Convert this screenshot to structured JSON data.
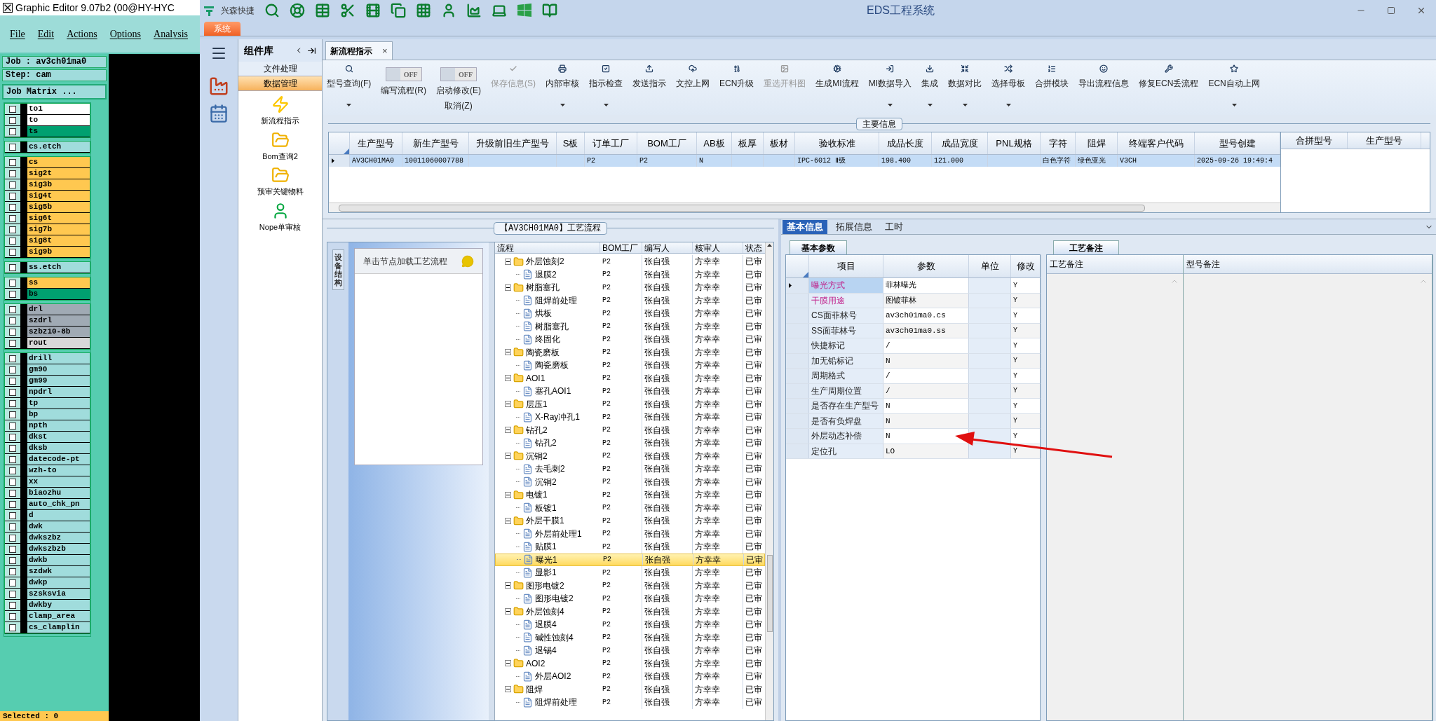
{
  "editor": {
    "title": "Graphic Editor 9.07b2 (00@HY-HYC",
    "menu": [
      "File",
      "Edit",
      "Actions",
      "Options",
      "Analysis"
    ],
    "job": "Job : av3ch01ma0",
    "step": "Step: cam",
    "matrix_button": "Job Matrix ...",
    "layer_groups": [
      [
        {
          "name": "to1",
          "color": "#ffffff",
          "checked": false
        },
        {
          "name": "to",
          "color": "#ffffff",
          "checked": false
        },
        {
          "name": "ts",
          "color": "#00a070",
          "checked": false
        }
      ],
      [
        {
          "name": "cs.etch",
          "color": "#a0dcdc",
          "checked": false
        }
      ],
      [
        {
          "name": "cs",
          "color": "#ffc850",
          "checked": false
        },
        {
          "name": "sig2t",
          "color": "#ffc850",
          "checked": false
        },
        {
          "name": "sig3b",
          "color": "#ffc850",
          "checked": false
        },
        {
          "name": "sig4t",
          "color": "#ffc850",
          "checked": false
        },
        {
          "name": "sig5b",
          "color": "#ffc850",
          "checked": false
        },
        {
          "name": "sig6t",
          "color": "#ffc850",
          "checked": false
        },
        {
          "name": "sig7b",
          "color": "#ffc850",
          "checked": false
        },
        {
          "name": "sig8t",
          "color": "#ffc850",
          "checked": false
        },
        {
          "name": "sig9b",
          "color": "#ffc850",
          "checked": false
        }
      ],
      [
        {
          "name": "ss.etch",
          "color": "#a0dcdc",
          "checked": false
        }
      ],
      [
        {
          "name": "ss",
          "color": "#ffc850",
          "checked": false
        },
        {
          "name": "bs",
          "color": "#00a070",
          "checked": false
        }
      ],
      [
        {
          "name": "drl",
          "color": "#a0aab4",
          "checked": false
        },
        {
          "name": "szdrl",
          "color": "#a0aab4",
          "checked": false
        },
        {
          "name": "szbz10-8b",
          "color": "#a0aab4",
          "checked": false
        },
        {
          "name": "rout",
          "color": "#d8d8d8",
          "checked": false
        }
      ],
      [
        {
          "name": "drill",
          "color": "#a0dcdc",
          "checked": false
        },
        {
          "name": "gm90",
          "color": "#a0dcdc",
          "checked": false
        },
        {
          "name": "gm99",
          "color": "#a0dcdc",
          "checked": false
        },
        {
          "name": "npdrl",
          "color": "#a0dcdc",
          "checked": false
        },
        {
          "name": "tp",
          "color": "#a0dcdc",
          "checked": false
        },
        {
          "name": "bp",
          "color": "#a0dcdc",
          "checked": false
        },
        {
          "name": "npth",
          "color": "#a0dcdc",
          "checked": false
        },
        {
          "name": "dkst",
          "color": "#a0dcdc",
          "checked": false
        },
        {
          "name": "dksb",
          "color": "#a0dcdc",
          "checked": false
        },
        {
          "name": "datecode-pt",
          "color": "#a0dcdc",
          "checked": false
        },
        {
          "name": "wzh-to",
          "color": "#a0dcdc",
          "checked": false
        },
        {
          "name": "xx",
          "color": "#a0dcdc",
          "checked": false
        },
        {
          "name": "biaozhu",
          "color": "#a0dcdc",
          "checked": false
        },
        {
          "name": "auto_chk_pn",
          "color": "#a0dcdc",
          "checked": false
        },
        {
          "name": "d",
          "color": "#a0dcdc",
          "checked": false
        },
        {
          "name": "dwk",
          "color": "#a0dcdc",
          "checked": false
        },
        {
          "name": "dwkszbz",
          "color": "#a0dcdc",
          "checked": false
        },
        {
          "name": "dwkszbzb",
          "color": "#a0dcdc",
          "checked": false
        },
        {
          "name": "dwkb",
          "color": "#a0dcdc",
          "checked": false
        },
        {
          "name": "szdwk",
          "color": "#a0dcdc",
          "checked": false
        },
        {
          "name": "dwkp",
          "color": "#a0dcdc",
          "checked": false
        },
        {
          "name": "szsksvia",
          "color": "#a0dcdc",
          "checked": false
        },
        {
          "name": "dwkby",
          "color": "#a0dcdc",
          "checked": false
        },
        {
          "name": "clamp_area",
          "color": "#a0dcdc",
          "checked": false
        },
        {
          "name": "cs_clamplin",
          "color": "#a0dcdc",
          "checked": false
        }
      ]
    ],
    "status": "Selected : 0"
  },
  "window": {
    "brand": "兴森快捷",
    "title": "EDS工程系统",
    "system_tab": "系统"
  },
  "component_library": {
    "title": "组件库",
    "sections": [
      {
        "label": "文件处理",
        "selected": false
      },
      {
        "label": "数据管理",
        "selected": true
      }
    ],
    "items": [
      "新流程指示",
      "Bom查询2",
      "预审关键物料",
      "Nope单审核"
    ]
  },
  "document_tab": {
    "label": "新流程指示",
    "close": "×"
  },
  "toolbar": [
    {
      "kind": "button",
      "label": "型号查询(F)",
      "disabled": false,
      "dropdown": true
    },
    {
      "kind": "toggle",
      "label": "编写流程(R)",
      "switch": "OFF",
      "on": false
    },
    {
      "kind": "toggle",
      "label": "启动修改(E)",
      "label2": "取消(Z)",
      "switch": "OFF",
      "on": false
    },
    {
      "kind": "button",
      "label": "保存信息(S)",
      "disabled": true,
      "dropdown": false
    },
    {
      "kind": "button",
      "label": "内部审核",
      "disabled": false,
      "dropdown": true
    },
    {
      "kind": "button",
      "label": "指示检查",
      "disabled": false,
      "dropdown": true
    },
    {
      "kind": "button",
      "label": "发送指示",
      "disabled": false,
      "dropdown": false
    },
    {
      "kind": "button",
      "label": "文控上网",
      "disabled": false,
      "dropdown": false
    },
    {
      "kind": "button",
      "label": "ECN升级",
      "disabled": false,
      "dropdown": false
    },
    {
      "kind": "button",
      "label": "重选开料图",
      "disabled": true,
      "dropdown": false
    },
    {
      "kind": "button",
      "label": "生成MI流程",
      "disabled": false,
      "dropdown": false
    },
    {
      "kind": "button",
      "label": "MI数据导入",
      "disabled": false,
      "dropdown": true
    },
    {
      "kind": "button",
      "label": "集成",
      "disabled": false,
      "dropdown": true
    },
    {
      "kind": "button",
      "label": "数据对比",
      "disabled": false,
      "dropdown": true
    },
    {
      "kind": "button",
      "label": "选择母板",
      "disabled": false,
      "dropdown": true
    },
    {
      "kind": "button",
      "label": "合拼模块",
      "disabled": false,
      "dropdown": false
    },
    {
      "kind": "button",
      "label": "导出流程信息",
      "disabled": false,
      "dropdown": false
    },
    {
      "kind": "button",
      "label": "修复ECN丢流程",
      "disabled": false,
      "dropdown": false
    },
    {
      "kind": "button",
      "label": "ECN自动上网",
      "disabled": false,
      "dropdown": true
    }
  ],
  "main_info": {
    "title": "主要信息",
    "columns": [
      "生产型号",
      "新生产型号",
      "升级前旧生产型号",
      "S板",
      "订单工厂",
      "BOM工厂",
      "AB板",
      "板厚",
      "板材",
      "验收标准",
      "成品长度",
      "成品宽度",
      "PNL规格",
      "字符",
      "阻焊",
      "终端客户代码",
      "型号创建"
    ],
    "rows": [
      {
        "selected": true,
        "cells": [
          "AV3CH01MA0",
          "10011060007788",
          null,
          null,
          "P2",
          "P2",
          "N",
          null,
          null,
          "IPC-6012 Ⅱ级",
          "198.400",
          "121.000",
          null,
          "白色字符",
          "绿色亚光",
          "V3CH",
          "2025-09-26 19:49:4"
        ]
      }
    ],
    "side_columns": [
      "合拼型号",
      "生产型号"
    ]
  },
  "process_flow": {
    "title": "【AV3CH01MA0】工艺流程",
    "side_tab": "设备结构",
    "hint": "单击节点加载工艺流程",
    "columns": [
      "流程",
      "BOM工厂",
      "编写人",
      "核审人",
      "状态"
    ],
    "tree": [
      {
        "name": "外层蚀刻2",
        "bom": "P2",
        "writer": "张自强",
        "reviewer": "方幸幸",
        "status": "已审",
        "expanded": true,
        "selected": false,
        "children": [
          {
            "name": "退膜2",
            "bom": "P2",
            "writer": "张自强",
            "reviewer": "方幸幸",
            "status": "已审",
            "selected": false
          }
        ]
      },
      {
        "name": "树脂塞孔",
        "bom": "P2",
        "writer": "张自强",
        "reviewer": "方幸幸",
        "status": "已审",
        "expanded": true,
        "selected": false,
        "children": [
          {
            "name": "阻焊前处理",
            "bom": "P2",
            "writer": "张自强",
            "reviewer": "方幸幸",
            "status": "已审",
            "selected": false
          },
          {
            "name": "烘板",
            "bom": "P2",
            "writer": "张自强",
            "reviewer": "方幸幸",
            "status": "已审",
            "selected": false
          },
          {
            "name": "树脂塞孔",
            "bom": "P2",
            "writer": "张自强",
            "reviewer": "方幸幸",
            "status": "已审",
            "selected": false
          },
          {
            "name": "终固化",
            "bom": "P2",
            "writer": "张自强",
            "reviewer": "方幸幸",
            "status": "已审",
            "selected": false
          }
        ]
      },
      {
        "name": "陶瓷磨板",
        "bom": "P2",
        "writer": "张自强",
        "reviewer": "方幸幸",
        "status": "已审",
        "expanded": true,
        "selected": false,
        "children": [
          {
            "name": "陶瓷磨板",
            "bom": "P2",
            "writer": "张自强",
            "reviewer": "方幸幸",
            "status": "已审",
            "selected": false
          }
        ]
      },
      {
        "name": "AOI1",
        "bom": "P2",
        "writer": "张自强",
        "reviewer": "方幸幸",
        "status": "已审",
        "expanded": true,
        "selected": false,
        "children": [
          {
            "name": "塞孔AOI1",
            "bom": "P2",
            "writer": "张自强",
            "reviewer": "方幸幸",
            "status": "已审",
            "selected": false
          }
        ]
      },
      {
        "name": "层压1",
        "bom": "P2",
        "writer": "张自强",
        "reviewer": "方幸幸",
        "status": "已审",
        "expanded": true,
        "selected": false,
        "children": [
          {
            "name": "X-Ray冲孔1",
            "bom": "P2",
            "writer": "张自强",
            "reviewer": "方幸幸",
            "status": "已审",
            "selected": false
          }
        ]
      },
      {
        "name": "钻孔2",
        "bom": "P2",
        "writer": "张自强",
        "reviewer": "方幸幸",
        "status": "已审",
        "expanded": true,
        "selected": false,
        "children": [
          {
            "name": "钻孔2",
            "bom": "P2",
            "writer": "张自强",
            "reviewer": "方幸幸",
            "status": "已审",
            "selected": false
          }
        ]
      },
      {
        "name": "沉铜2",
        "bom": "P2",
        "writer": "张自强",
        "reviewer": "方幸幸",
        "status": "已审",
        "expanded": true,
        "selected": false,
        "children": [
          {
            "name": "去毛刺2",
            "bom": "P2",
            "writer": "张自强",
            "reviewer": "方幸幸",
            "status": "已审",
            "selected": false
          },
          {
            "name": "沉铜2",
            "bom": "P2",
            "writer": "张自强",
            "reviewer": "方幸幸",
            "status": "已审",
            "selected": false
          }
        ]
      },
      {
        "name": "电镀1",
        "bom": "P2",
        "writer": "张自强",
        "reviewer": "方幸幸",
        "status": "已审",
        "expanded": true,
        "selected": false,
        "children": [
          {
            "name": "板镀1",
            "bom": "P2",
            "writer": "张自强",
            "reviewer": "方幸幸",
            "status": "已审",
            "selected": false
          }
        ]
      },
      {
        "name": "外层干膜1",
        "bom": "P2",
        "writer": "张自强",
        "reviewer": "方幸幸",
        "status": "已审",
        "expanded": true,
        "selected": false,
        "children": [
          {
            "name": "外层前处理1",
            "bom": "P2",
            "writer": "张自强",
            "reviewer": "方幸幸",
            "status": "已审",
            "selected": false
          },
          {
            "name": "贴膜1",
            "bom": "P2",
            "writer": "张自强",
            "reviewer": "方幸幸",
            "status": "已审",
            "selected": false
          },
          {
            "name": "曝光1",
            "bom": "P2",
            "writer": "张自强",
            "reviewer": "方幸幸",
            "status": "已审",
            "selected": true
          },
          {
            "name": "显影1",
            "bom": "P2",
            "writer": "张自强",
            "reviewer": "方幸幸",
            "status": "已审",
            "selected": false
          }
        ]
      },
      {
        "name": "图形电镀2",
        "bom": "P2",
        "writer": "张自强",
        "reviewer": "方幸幸",
        "status": "已审",
        "expanded": true,
        "selected": false,
        "children": [
          {
            "name": "图形电镀2",
            "bom": "P2",
            "writer": "张自强",
            "reviewer": "方幸幸",
            "status": "已审",
            "selected": false
          }
        ]
      },
      {
        "name": "外层蚀刻4",
        "bom": "P2",
        "writer": "张自强",
        "reviewer": "方幸幸",
        "status": "已审",
        "expanded": true,
        "selected": false,
        "children": [
          {
            "name": "退膜4",
            "bom": "P2",
            "writer": "张自强",
            "reviewer": "方幸幸",
            "status": "已审",
            "selected": false
          },
          {
            "name": "碱性蚀刻4",
            "bom": "P2",
            "writer": "张自强",
            "reviewer": "方幸幸",
            "status": "已审",
            "selected": false
          },
          {
            "name": "退锡4",
            "bom": "P2",
            "writer": "张自强",
            "reviewer": "方幸幸",
            "status": "已审",
            "selected": false
          }
        ]
      },
      {
        "name": "AOI2",
        "bom": "P2",
        "writer": "张自强",
        "reviewer": "方幸幸",
        "status": "已审",
        "expanded": true,
        "selected": false,
        "children": [
          {
            "name": "外层AOI2",
            "bom": "P2",
            "writer": "张自强",
            "reviewer": "方幸幸",
            "status": "已审",
            "selected": false
          }
        ]
      },
      {
        "name": "阻焊",
        "bom": "P2",
        "writer": "张自强",
        "reviewer": "方幸幸",
        "status": "已审",
        "expanded": true,
        "selected": false,
        "children": [
          {
            "name": "阻焊前处理",
            "bom": "P2",
            "writer": "张自强",
            "reviewer": "方幸幸",
            "status": "已审",
            "selected": false
          }
        ]
      }
    ]
  },
  "detail": {
    "tabs": [
      {
        "label": "基本信息",
        "selected": true
      },
      {
        "label": "拓展信息",
        "selected": false
      },
      {
        "label": "工时",
        "selected": false
      }
    ],
    "subtab": "基本参数",
    "columns": [
      "项目",
      "参数",
      "单位",
      "修改"
    ],
    "rows": [
      {
        "item": "曝光方式",
        "value": "菲林曝光",
        "modify": "Y",
        "highlighted": true,
        "selected": true
      },
      {
        "item": "干膜用途",
        "value": "图镀菲林",
        "modify": "Y",
        "highlighted": true,
        "selected": false
      },
      {
        "item": "CS面菲林号",
        "value": "av3ch01ma0.cs",
        "modify": "Y",
        "highlighted": false,
        "selected": false
      },
      {
        "item": "SS面菲林号",
        "value": "av3ch01ma0.ss",
        "modify": "Y",
        "highlighted": false,
        "selected": false
      },
      {
        "item": "快捷标记",
        "value": "/",
        "modify": "Y",
        "highlighted": false,
        "selected": false
      },
      {
        "item": "加无铅标记",
        "value": "N",
        "modify": "Y",
        "highlighted": false,
        "selected": false
      },
      {
        "item": "周期格式",
        "value": "/",
        "modify": "Y",
        "highlighted": false,
        "selected": false
      },
      {
        "item": "生产周期位置",
        "value": "/",
        "modify": "Y",
        "highlighted": false,
        "selected": false
      },
      {
        "item": "是否存在生产型号",
        "value": "N",
        "modify": "Y",
        "highlighted": false,
        "selected": false
      },
      {
        "item": "是否有负焊盘",
        "value": "N",
        "modify": "Y",
        "highlighted": false,
        "selected": false
      },
      {
        "item": "外层动态补偿",
        "value": "N",
        "modify": "Y",
        "highlighted": false,
        "selected": false
      },
      {
        "item": "定位孔",
        "value": "LO",
        "modify": "Y",
        "highlighted": false,
        "selected": false
      }
    ],
    "notes_tab": "工艺备注",
    "notes_columns": [
      "工艺备注",
      "型号备注"
    ]
  }
}
